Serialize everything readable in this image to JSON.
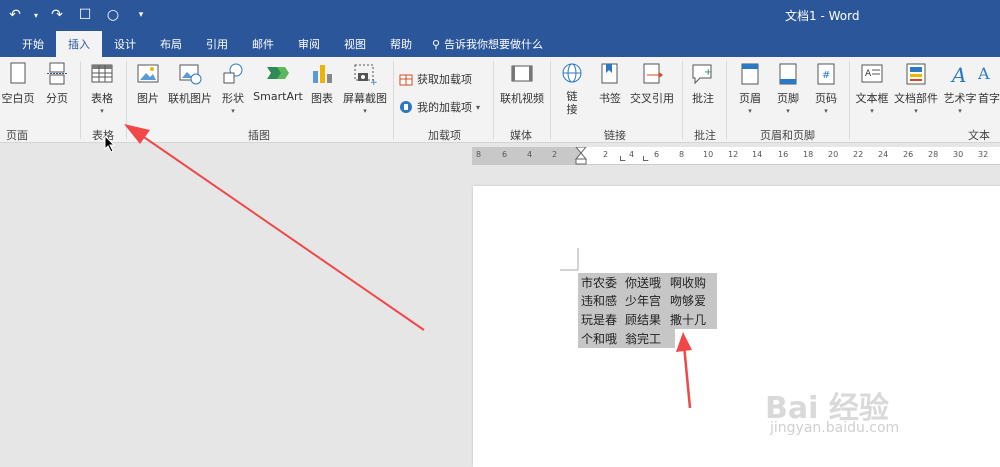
{
  "title": "文档1  -  Word",
  "tabs": [
    "开始",
    "插入",
    "设计",
    "布局",
    "引用",
    "邮件",
    "审阅",
    "视图",
    "帮助"
  ],
  "tell_me": "告诉我你想要做什么",
  "ribbon": {
    "buttons": {
      "blank_page": "空白页",
      "page_break": "分页",
      "table": "表格",
      "picture": "图片",
      "online_picture": "联机图片",
      "shapes": "形状",
      "smartart": "SmartArt",
      "chart": "图表",
      "screenshot": "屏幕截图",
      "get_addins": "获取加载项",
      "my_addins": "我的加载项",
      "online_video": "联机视频",
      "link": "链\n接",
      "bookmark": "书签",
      "cross_ref": "交叉引用",
      "comment": "批注",
      "header": "页眉",
      "footer": "页脚",
      "page_number": "页码",
      "textbox": "文本框",
      "doc_parts": "文档部件",
      "wordart": "艺术字",
      "dropcap": "首字"
    },
    "groups": {
      "pages": "页面",
      "tables": "表格",
      "illustrations": "插图",
      "addins": "加载项",
      "media": "媒体",
      "links": "链接",
      "comments": "批注",
      "header_footer": "页眉和页脚",
      "text": "文本"
    }
  },
  "ruler_numbers": [
    "8",
    "6",
    "4",
    "2",
    "2",
    "4",
    "6",
    "8",
    "10",
    "12",
    "14",
    "16",
    "18",
    "20",
    "22",
    "24",
    "26",
    "28",
    "30",
    "32"
  ],
  "table_rows": [
    [
      "市农委",
      "你送哦",
      "啊收购"
    ],
    [
      "违和感",
      "少年宫",
      "吻够爱"
    ],
    [
      "玩是春",
      "顾结果",
      "撒十几"
    ],
    [
      "个和哦",
      "翁完工",
      ""
    ]
  ],
  "watermark": "Bai 经验",
  "watermark_sub": "jingyan.baidu.com",
  "colors": {
    "accent": "#2b579a",
    "arrow": "#f04848"
  }
}
